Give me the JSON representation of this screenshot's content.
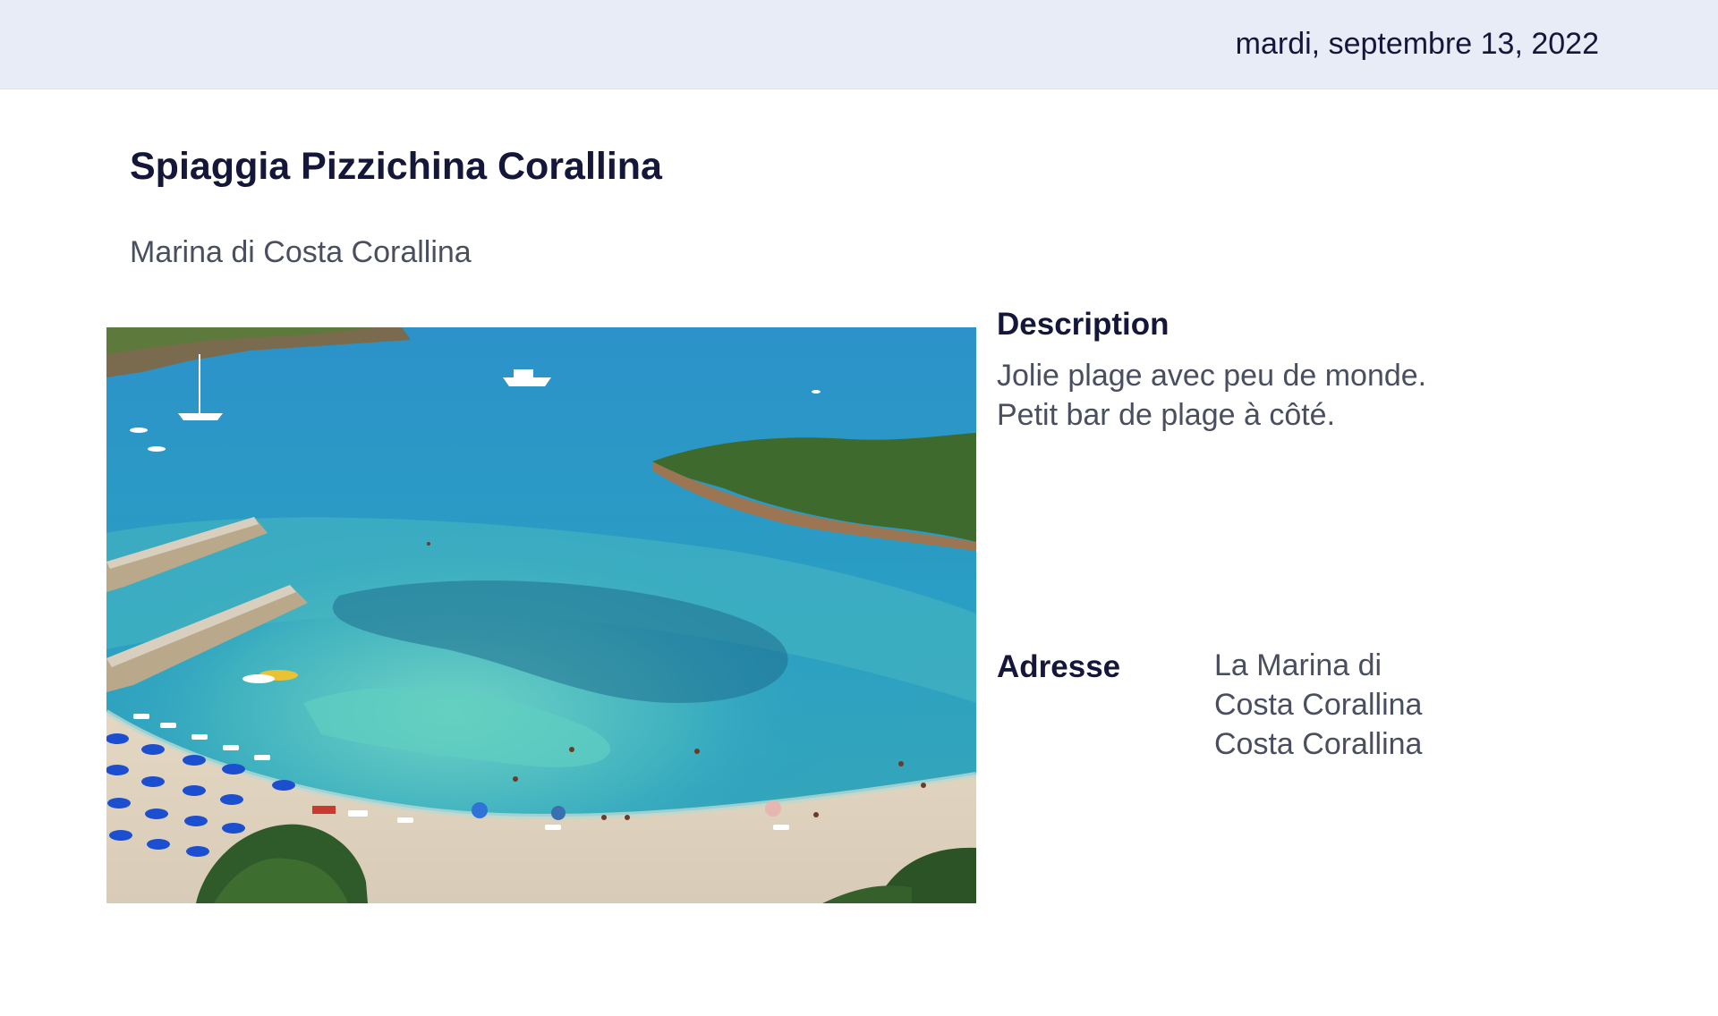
{
  "header": {
    "date": "mardi, septembre 13, 2022"
  },
  "place": {
    "title": "Spiaggia Pizzichina Corallina",
    "subtitle": "Marina di Costa Corallina"
  },
  "description": {
    "label": "Description",
    "lines": [
      "Jolie plage avec peu de monde.",
      "Petit bar de plage à côté."
    ]
  },
  "address": {
    "label": "Adresse",
    "lines": [
      "La Marina di",
      "Costa Corallina",
      "Costa Corallina"
    ]
  },
  "colors": {
    "header_bg": "#e8ecf7",
    "title": "#14163a",
    "body_text": "#4a4f60",
    "sea_deep": "#1d7fb4",
    "sea_shallow": "#52c1c4",
    "sand": "#e6dccb",
    "umbrella": "#1c4fd0"
  },
  "photo": {
    "subject": "aerial beach photo",
    "icon": "beach-photo-image"
  }
}
